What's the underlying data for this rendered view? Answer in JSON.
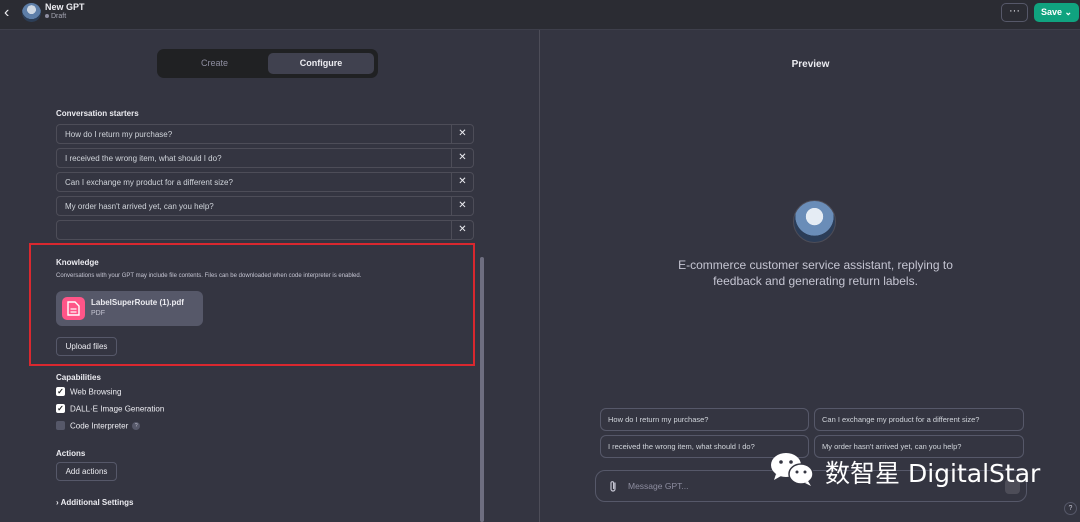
{
  "header": {
    "gpt_name": "New GPT",
    "status": "Draft",
    "more_label": "···",
    "save_label": "Save ⌄"
  },
  "tabs": [
    {
      "label": "Create",
      "active": false
    },
    {
      "label": "Configure",
      "active": true
    }
  ],
  "conversation_starters": {
    "label": "Conversation starters",
    "items": [
      "How do I return my purchase?",
      "I received the wrong item, what should I do?",
      "Can I exchange my product for a different size?",
      "My order hasn't arrived yet, can you help?",
      ""
    ],
    "remove_glyph": "✕"
  },
  "knowledge": {
    "label": "Knowledge",
    "description": "Conversations with your GPT may include file contents. Files can be downloaded when code interpreter is enabled.",
    "file": {
      "name": "LabelSuperRoute (1).pdf",
      "type": "PDF",
      "icon": "document-icon",
      "color": "#ff5588"
    },
    "upload_label": "Upload files"
  },
  "capabilities": {
    "label": "Capabilities",
    "items": [
      {
        "label": "Web Browsing",
        "checked": true
      },
      {
        "label": "DALL·E Image Generation",
        "checked": true
      },
      {
        "label": "Code Interpreter",
        "checked": false
      }
    ],
    "help_glyph": "?"
  },
  "actions": {
    "label": "Actions",
    "add_label": "Add actions"
  },
  "additional_settings": "› Additional Settings",
  "preview": {
    "title": "Preview",
    "description": "E-commerce customer service assistant, replying to feedback and generating return labels.",
    "chips": [
      "How do I return my purchase?",
      "Can I exchange my product for a different size?",
      "I received the wrong item, what should I do?",
      "My order hasn't arrived yet, can you help?"
    ],
    "message_placeholder": "Message GPT...",
    "help_glyph": "?"
  },
  "watermark": {
    "text": "数智星 DigitalStar"
  },
  "colors": {
    "accent": "#10a37f",
    "highlight_border": "#d9282f",
    "file_icon": "#ff5588"
  }
}
